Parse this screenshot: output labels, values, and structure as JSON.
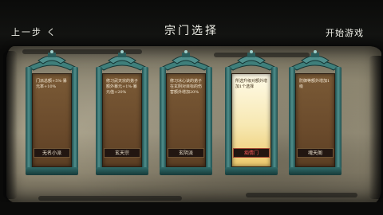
{
  "header": {
    "back_label": "上一步 く",
    "title": "宗门选择",
    "start_label": "开始游戏"
  },
  "colors": {
    "selected_name": "#ff5a5a",
    "pillar": "#4f8f8c",
    "parchment": "#a39b83"
  },
  "sects": [
    {
      "name": "无名小派",
      "desc": "门派总额+5%·暴元率+10%",
      "selected": false
    },
    {
      "name": "玄天宗",
      "desc": "修习武天宗的弟子额外暴元+1%·暴元值+20%",
      "selected": false
    },
    {
      "name": "玄阴派",
      "desc": "修习冰心诀的弟子在玄阴对目标的伤害额外增加20%",
      "selected": false
    },
    {
      "name": "痴情门",
      "desc": "所选升级对额外增加1个选择",
      "selected": true
    },
    {
      "name": "魂天阁",
      "desc": "防御等额外增加1级",
      "selected": false
    }
  ]
}
